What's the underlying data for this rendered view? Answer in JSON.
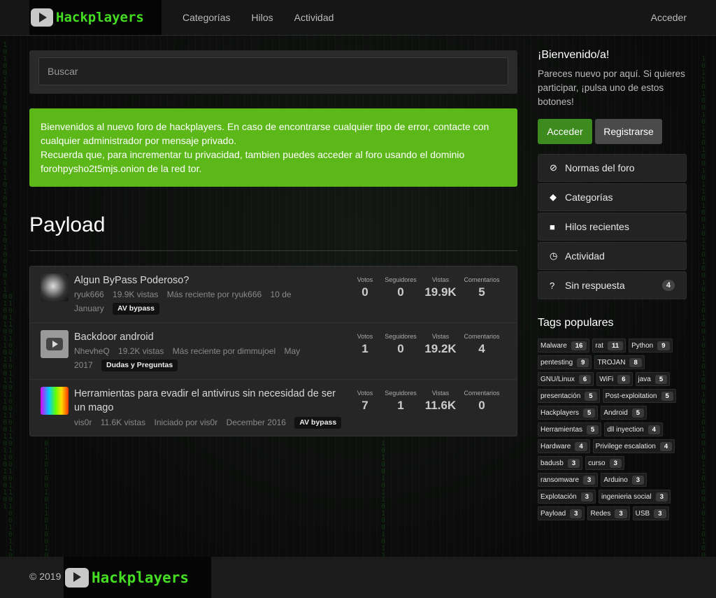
{
  "brand": {
    "logo_text": "Hackplayers"
  },
  "nav": {
    "links": [
      "Categorías",
      "Hilos",
      "Actividad"
    ],
    "login": "Acceder"
  },
  "search": {
    "placeholder": "Buscar"
  },
  "alert": {
    "line1": "Bienvenidos al nuevo foro de hackplayers. En caso de encontrarse cualquier tipo de error, contacte con cualquier administrador por mensaje privado.",
    "line2": "Recuerda que, para incrementar tu privacidad, tambien puedes acceder al foro usando el dominio forohpysho2t5mjs.onion de la red tor."
  },
  "page": {
    "title": "Payload"
  },
  "stat_labels": {
    "votes": "Votos",
    "followers": "Seguidores",
    "views": "Vistas",
    "comments": "Comentarios"
  },
  "topics": [
    {
      "title": "Algun ByPass Poderoso?",
      "author": "ryuk666",
      "views": "19.9K vistas",
      "recent": "Más reciente por ryuk666",
      "date": "10 de January",
      "tag": "AV bypass",
      "votes": "0",
      "followers": "0",
      "views_count": "19.9K",
      "comments": "5"
    },
    {
      "title": "Backdoor android",
      "author": "NhevheQ",
      "views": "19.2K vistas",
      "recent": "Más reciente por dimmujoel",
      "date": "May 2017",
      "tag": "Dudas y Preguntas",
      "votes": "1",
      "followers": "0",
      "views_count": "19.2K",
      "comments": "4"
    },
    {
      "title": "Herramientas para evadir el antivirus sin necesidad de ser un mago",
      "author": "vis0r",
      "views": "11.6K vistas",
      "recent": "Iniciado por vis0r",
      "date": "December 2016",
      "tag": "AV bypass",
      "votes": "7",
      "followers": "1",
      "views_count": "11.6K",
      "comments": "0"
    }
  ],
  "sidebar": {
    "welcome_title": "¡Bienvenido/a!",
    "welcome_text": "Pareces nuevo por aquí. Si quieres participar, ¡pulsa uno de estos botones!",
    "btn_login": "Acceder",
    "btn_register": "Registrarse",
    "menu": [
      {
        "label": "Normas del foro",
        "icon": "ban-icon"
      },
      {
        "label": "Categorías",
        "icon": "tags-icon"
      },
      {
        "label": "Hilos recientes",
        "icon": "comments-icon"
      },
      {
        "label": "Actividad",
        "icon": "clock-icon"
      },
      {
        "label": "Sin respuesta",
        "icon": "question-icon",
        "count": "4"
      }
    ],
    "tags_title": "Tags populares",
    "tags": [
      {
        "name": "Malware",
        "count": "16"
      },
      {
        "name": "rat",
        "count": "11"
      },
      {
        "name": "Python",
        "count": "9"
      },
      {
        "name": "pentesting",
        "count": "9"
      },
      {
        "name": "TROJAN",
        "count": "8"
      },
      {
        "name": "GNU/Linux",
        "count": "6"
      },
      {
        "name": "WiFi",
        "count": "6"
      },
      {
        "name": "java",
        "count": "5"
      },
      {
        "name": "presentación",
        "count": "5"
      },
      {
        "name": "Post-exploitation",
        "count": "5"
      },
      {
        "name": "Hackplayers",
        "count": "5"
      },
      {
        "name": "Android",
        "count": "5"
      },
      {
        "name": "Herramientas",
        "count": "5"
      },
      {
        "name": "dll inyection",
        "count": "4"
      },
      {
        "name": "Hardware",
        "count": "4"
      },
      {
        "name": "Privilege escalation",
        "count": "4"
      },
      {
        "name": "badusb",
        "count": "3"
      },
      {
        "name": "curso",
        "count": "3"
      },
      {
        "name": "ransomware",
        "count": "3"
      },
      {
        "name": "Arduino",
        "count": "3"
      },
      {
        "name": "Explotación",
        "count": "3"
      },
      {
        "name": "ingenieria social",
        "count": "3"
      },
      {
        "name": "Payload",
        "count": "3"
      },
      {
        "name": "Redes",
        "count": "3"
      },
      {
        "name": "USB",
        "count": "3"
      }
    ]
  },
  "footer": {
    "copyright": "© 2019"
  }
}
